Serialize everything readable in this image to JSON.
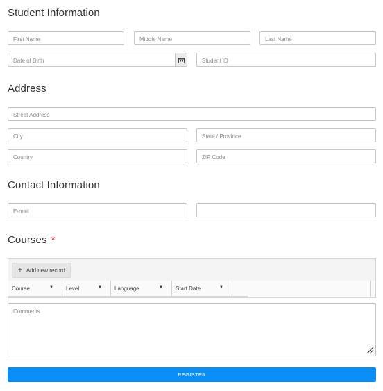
{
  "sections": {
    "student": {
      "title": "Student Information"
    },
    "address": {
      "title": "Address"
    },
    "contact": {
      "title": "Contact Information"
    },
    "courses": {
      "title": "Courses",
      "required_marker": "*"
    }
  },
  "fields": {
    "first_name": {
      "placeholder": "First Name",
      "value": ""
    },
    "middle_name": {
      "placeholder": "Middle Name",
      "value": ""
    },
    "last_name": {
      "placeholder": "Last Name",
      "value": ""
    },
    "dob": {
      "placeholder": "Date of Birth",
      "value": ""
    },
    "student_id": {
      "placeholder": "Student ID",
      "value": ""
    },
    "street": {
      "placeholder": "Street Address",
      "value": ""
    },
    "city": {
      "placeholder": "City",
      "value": ""
    },
    "state": {
      "placeholder": "State / Province",
      "value": ""
    },
    "country": {
      "placeholder": "Country",
      "value": ""
    },
    "zip": {
      "placeholder": "ZIP Code",
      "value": ""
    },
    "email": {
      "placeholder": "E-mail",
      "value": ""
    },
    "phone": {
      "placeholder": "",
      "value": ""
    },
    "comments": {
      "placeholder": "Comments",
      "value": ""
    }
  },
  "courses_grid": {
    "add_button": {
      "icon": "plus-icon",
      "label": "Add new record"
    },
    "columns": [
      {
        "label": "Course",
        "icon": "sort-arrow-icon"
      },
      {
        "label": "Level",
        "icon": "sort-arrow-icon"
      },
      {
        "label": "Language",
        "icon": "sort-arrow-icon"
      },
      {
        "label": "Start Date",
        "icon": "sort-arrow-icon"
      }
    ]
  },
  "register_button": {
    "label": "REGISTER"
  },
  "colors": {
    "accent": "#0a8ef5",
    "required": "#e0281e",
    "border": "#c7c7c7"
  }
}
